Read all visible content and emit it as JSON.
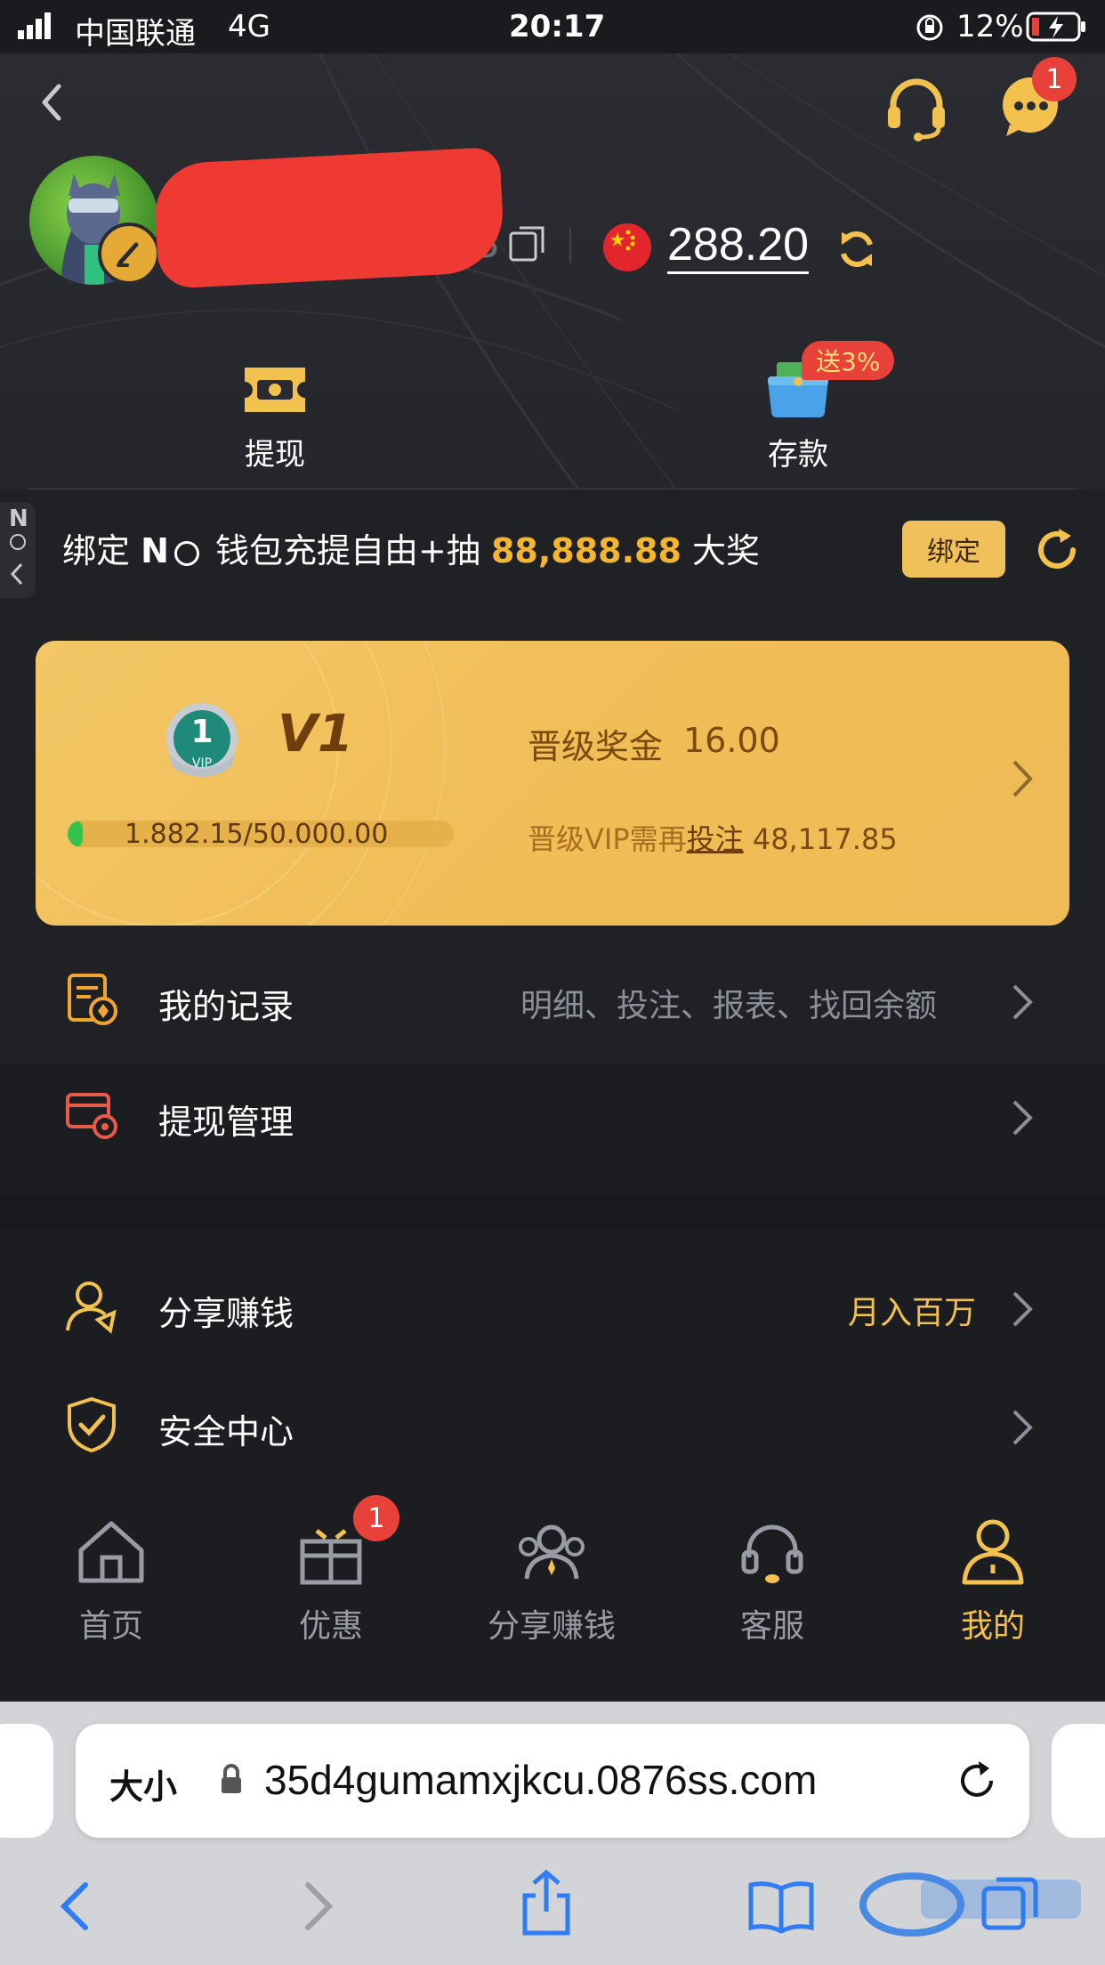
{
  "status_bar": {
    "carrier": "中国联通",
    "network": "4G",
    "time": "20:17",
    "battery": "12%"
  },
  "header": {
    "notification_count": "1",
    "balance": "288.20",
    "account_partial": "188"
  },
  "quick_actions": {
    "withdraw": "提现",
    "deposit": "存款",
    "deposit_badge": "送3%"
  },
  "side_tab": {
    "letters": "N"
  },
  "bind_banner": {
    "prefix": "绑定",
    "brand": "N",
    "text": "钱包充提自由+抽",
    "amount": "88,888.88",
    "suffix": "大奖",
    "button": "绑定"
  },
  "vip": {
    "badge_number": "1",
    "badge_text": "VIP",
    "level": "V1",
    "bonus_label": "晋级奖金",
    "bonus_value": "16.00",
    "progress_text": "1.882.15/50.000.00",
    "progress_fraction": 0.0376,
    "upgrade_prefix": "晋级VIP需再",
    "upgrade_link": "投注",
    "upgrade_value": "48,117.85"
  },
  "menu": {
    "records": {
      "label": "我的记录",
      "sub": "明细、投注、报表、找回余额"
    },
    "withdraw_mgmt": {
      "label": "提现管理"
    },
    "share": {
      "label": "分享赚钱",
      "sub": "月入百万"
    },
    "security": {
      "label": "安全中心"
    }
  },
  "tabs": [
    {
      "label": "首页"
    },
    {
      "label": "优惠",
      "badge": "1"
    },
    {
      "label": "分享赚钱"
    },
    {
      "label": "客服"
    },
    {
      "label": "我的"
    }
  ],
  "safari": {
    "text_size": "大小",
    "url": "35d4gumamxjkcu.0876ss.com"
  },
  "colors": {
    "accent": "#f2c14e",
    "vip_card": "#f0bc55",
    "badge_red": "#e8413a",
    "background": "#1c1d21",
    "safari_blue": "#2e7cf6"
  }
}
